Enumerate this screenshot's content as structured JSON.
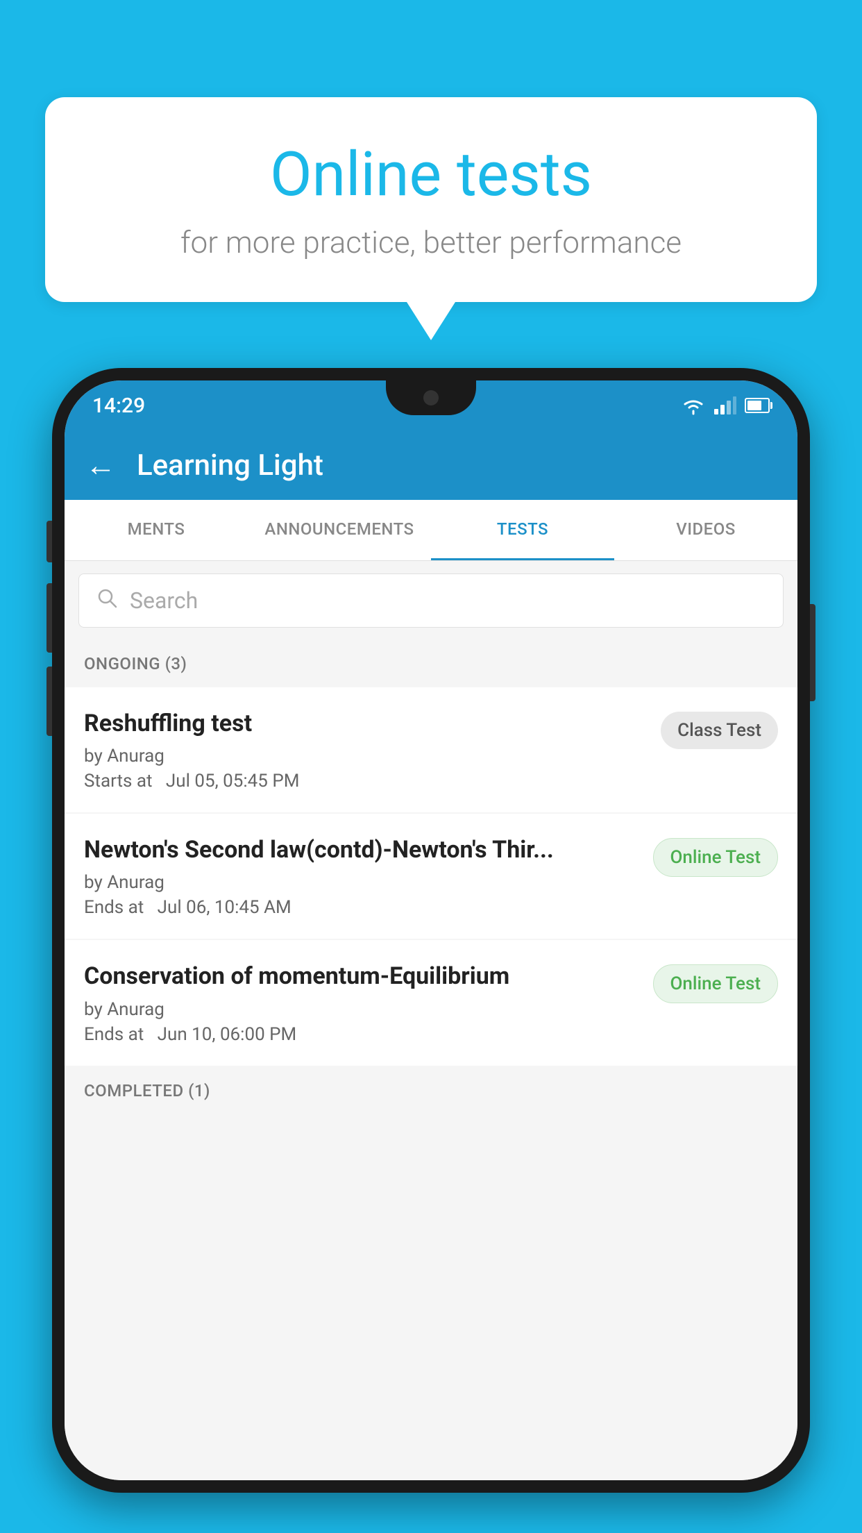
{
  "background_color": "#1bb8e8",
  "speech_bubble": {
    "title": "Online tests",
    "subtitle": "for more practice, better performance"
  },
  "phone": {
    "status_bar": {
      "time": "14:29"
    },
    "app_header": {
      "back_label": "←",
      "title": "Learning Light"
    },
    "tabs": [
      {
        "label": "MENTS",
        "active": false
      },
      {
        "label": "ANNOUNCEMENTS",
        "active": false
      },
      {
        "label": "TESTS",
        "active": true
      },
      {
        "label": "VIDEOS",
        "active": false
      }
    ],
    "search": {
      "placeholder": "Search"
    },
    "ongoing_section": {
      "header": "ONGOING (3)",
      "tests": [
        {
          "title": "Reshuffling test",
          "by": "by Anurag",
          "date": "Starts at  Jul 05, 05:45 PM",
          "badge": "Class Test",
          "badge_type": "class"
        },
        {
          "title": "Newton's Second law(contd)-Newton's Thir...",
          "by": "by Anurag",
          "date": "Ends at  Jul 06, 10:45 AM",
          "badge": "Online Test",
          "badge_type": "online"
        },
        {
          "title": "Conservation of momentum-Equilibrium",
          "by": "by Anurag",
          "date": "Ends at  Jun 10, 06:00 PM",
          "badge": "Online Test",
          "badge_type": "online"
        }
      ]
    },
    "completed_section": {
      "header": "COMPLETED (1)"
    }
  }
}
